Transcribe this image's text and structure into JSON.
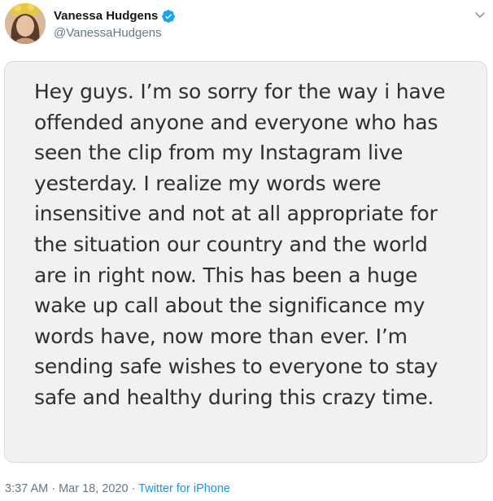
{
  "author": {
    "display_name": "Vanessa Hudgens",
    "handle": "@VanessaHudgens",
    "verified": true,
    "avatar_icon": "profile-photo"
  },
  "note": {
    "lines": [
      "Hey guys. I’m so sorry for the way i have",
      "offended anyone and everyone who has",
      "seen the clip from my Instagram live",
      "yesterday. I realize my words were",
      "insensitive and not at all appropriate for",
      "the situation our country and the world",
      "are in right now. This has been a huge",
      "wake up call about the significance my",
      "words have, now more than ever. I’m",
      "sending safe wishes to everyone to stay",
      "safe and healthy during this crazy time."
    ]
  },
  "meta": {
    "time": "3:37 AM",
    "separator": " · ",
    "date": "Mar 18, 2020",
    "source": "Twitter for iPhone"
  },
  "colors": {
    "verified_badge": "#1da1f2",
    "link": "#1b95e0",
    "muted": "#657786"
  }
}
